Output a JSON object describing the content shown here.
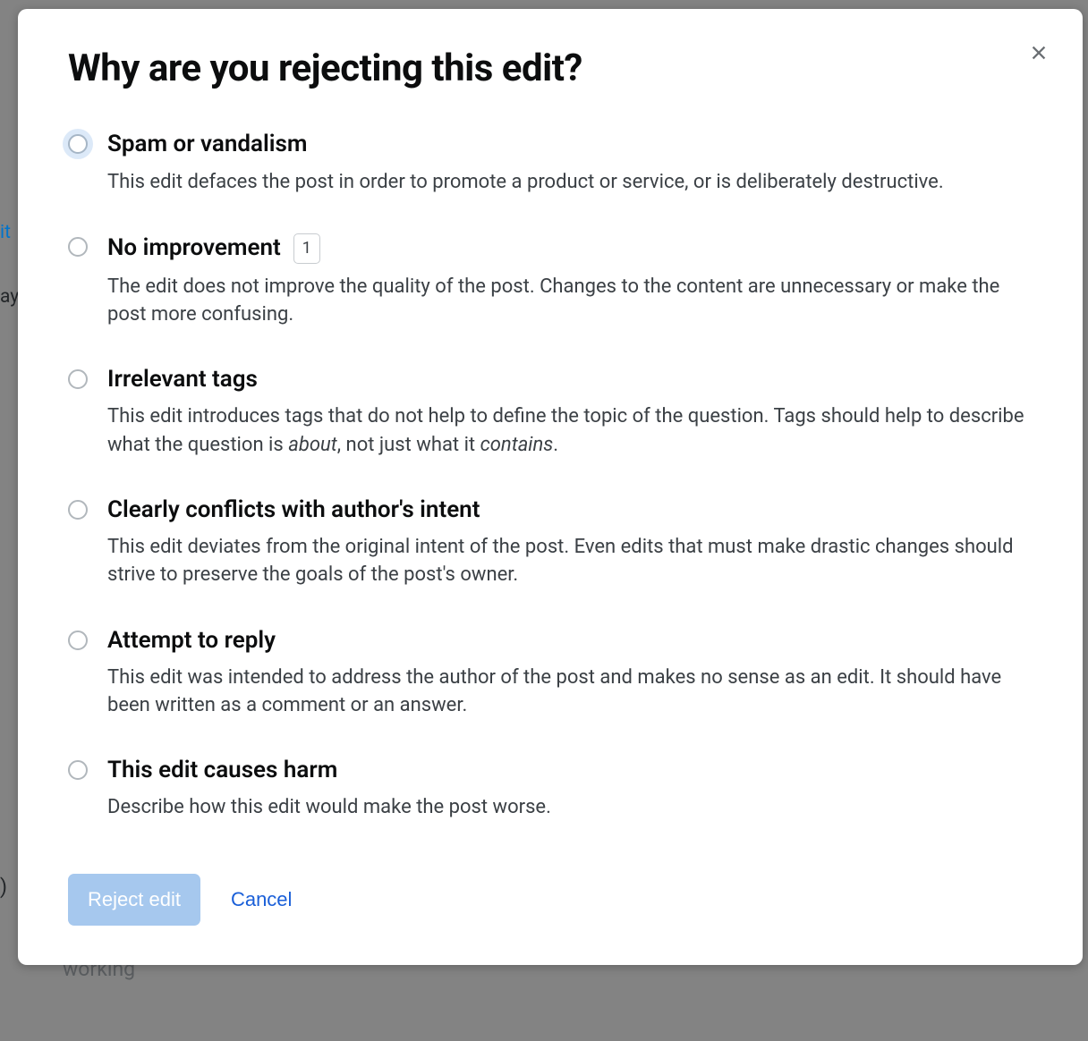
{
  "modal": {
    "title": "Why are you rejecting this edit?",
    "close_label": "Close"
  },
  "options": [
    {
      "key": "spam",
      "title": "Spam or vandalism",
      "desc": "This edit defaces the post in order to promote a product or service, or is deliberately destructive.",
      "focused": true,
      "count": null
    },
    {
      "key": "no-improvement",
      "title": "No improvement",
      "desc": "The edit does not improve the quality of the post. Changes to the content are unnecessary or make the post more confusing.",
      "focused": false,
      "count": "1"
    },
    {
      "key": "irrelevant-tags",
      "title": "Irrelevant tags",
      "desc_html": "This edit introduces tags that do not help to define the topic of the question. Tags should help to describe what the question is <em>about</em>, not just what it <em>contains</em>.",
      "focused": false,
      "count": null
    },
    {
      "key": "conflicts-intent",
      "title": "Clearly conflicts with author's intent",
      "desc": "This edit deviates from the original intent of the post. Even edits that must make drastic changes should strive to preserve the goals of the post's owner.",
      "focused": false,
      "count": null
    },
    {
      "key": "attempt-reply",
      "title": "Attempt to reply",
      "desc": "This edit was intended to address the author of the post and makes no sense as an edit. It should have been written as a comment or an answer.",
      "focused": false,
      "count": null
    },
    {
      "key": "causes-harm",
      "title": "This edit causes harm",
      "desc": "Describe how this edit would make the post worse.",
      "focused": false,
      "count": null
    }
  ],
  "actions": {
    "reject_label": "Reject edit",
    "cancel_label": "Cancel"
  },
  "backdrop": {
    "fragments": [
      "it",
      "ay",
      ")",
      "working"
    ]
  }
}
